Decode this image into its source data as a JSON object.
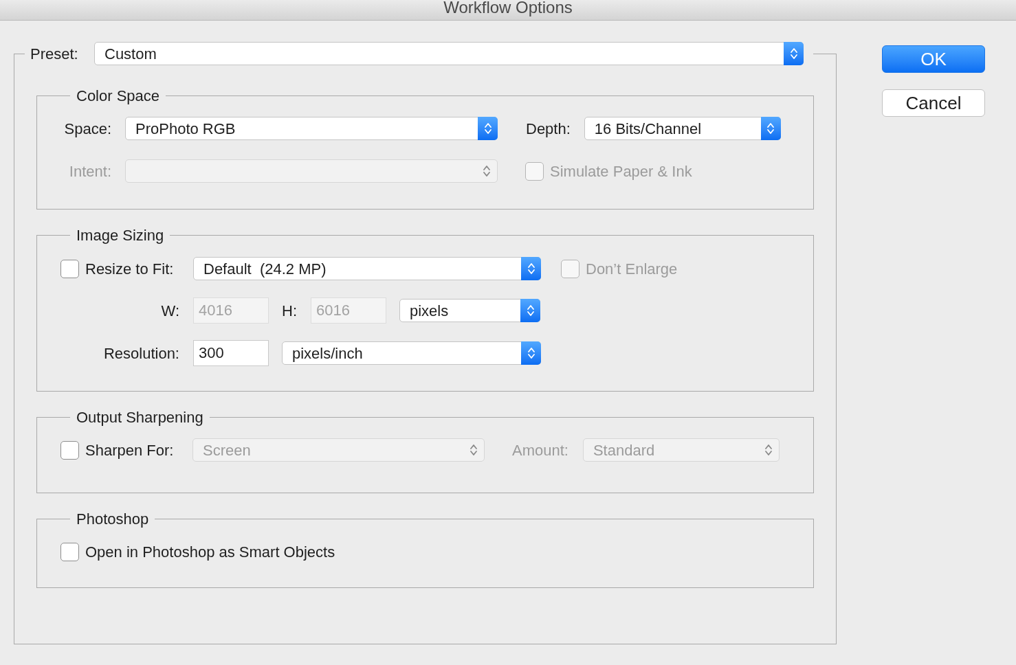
{
  "window": {
    "title": "Workflow Options"
  },
  "preset": {
    "label": "Preset:",
    "value": "Custom"
  },
  "buttons": [
    {
      "label": "OK",
      "kind": "default"
    },
    {
      "label": "Cancel",
      "kind": "normal"
    }
  ],
  "color_space": {
    "title": "Color Space",
    "space": {
      "label": "Space:",
      "value": "ProPhoto RGB",
      "disabled": false
    },
    "depth": {
      "label": "Depth:",
      "value": "16 Bits/Channel",
      "disabled": false
    },
    "intent": {
      "label": "Intent:",
      "disabled": true
    },
    "simulate": {
      "label": "Simulate Paper & Ink",
      "checked": false,
      "disabled": true
    }
  },
  "image_sizing": {
    "title": "Image Sizing",
    "resize": {
      "label": "Resize to Fit:",
      "checked": false,
      "disabled": false
    },
    "size": {
      "value": "Default  (24.2 MP)",
      "disabled": false
    },
    "dont_enlarge": {
      "label": "Don’t Enlarge",
      "checked": false,
      "disabled": true
    },
    "width": {
      "label": "W:",
      "value": "4016",
      "disabled": true
    },
    "height": {
      "label": "H:",
      "value": "6016",
      "disabled": true
    },
    "units": {
      "value": "pixels",
      "disabled": false
    },
    "resolution": {
      "label": "Resolution:",
      "value": "300",
      "disabled": false
    },
    "resolution_units": {
      "value": "pixels/inch",
      "disabled": false
    }
  },
  "output_sharpening": {
    "title": "Output Sharpening",
    "sharpen": {
      "label": "Sharpen For:",
      "checked": false,
      "disabled": false
    },
    "sharpen_for": {
      "value": "Screen",
      "disabled": true
    },
    "amount": {
      "label": "Amount:",
      "value": "Standard",
      "disabled": true
    }
  },
  "photoshop": {
    "title": "Photoshop",
    "smart_objects": {
      "label": "Open in Photoshop as Smart Objects",
      "checked": false,
      "disabled": false
    }
  }
}
